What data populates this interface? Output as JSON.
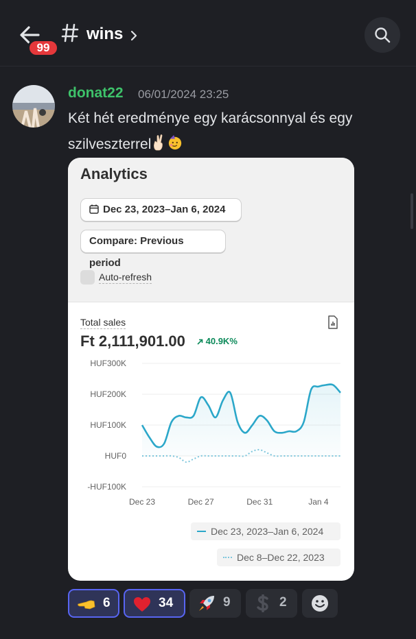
{
  "header": {
    "unread_count": "99",
    "channel_name": "wins"
  },
  "message": {
    "author": "donat22",
    "timestamp": "06/01/2024 23:25",
    "text_line1": "Két hét eredménye egy karácsonnyal és egy",
    "text_line2": "szilveszterrel"
  },
  "card": {
    "title": "Analytics",
    "date_range": "Dec 23, 2023–Jan 6, 2024",
    "compare": "Compare: Previous period",
    "auto_refresh": "Auto-refresh",
    "metric_label": "Total sales",
    "metric_value": "Ft 2,111,901.00",
    "metric_change": "40.9K%",
    "legend_current": "Dec 23, 2023–Jan 6, 2024",
    "legend_previous": "Dec 8–Dec 22, 2023"
  },
  "chart_data": {
    "type": "line",
    "y_ticks": [
      "HUF300K",
      "HUF200K",
      "HUF100K",
      "HUF0",
      "-HUF100K"
    ],
    "y_tick_values": [
      300000,
      200000,
      100000,
      0,
      -100000
    ],
    "ylim": [
      -100000,
      300000
    ],
    "x_tick_labels": [
      "Dec 23",
      "Dec 27",
      "Dec 31",
      "Jan 4"
    ],
    "x_tick_positions": [
      0,
      4,
      8,
      12
    ],
    "series": [
      {
        "name": "Dec 23, 2023–Jan 6, 2024",
        "color": "#2ba7c9",
        "points": [
          [
            0,
            100000
          ],
          [
            0.5,
            60000
          ],
          [
            1,
            30000
          ],
          [
            1.5,
            40000
          ],
          [
            2,
            110000
          ],
          [
            2.5,
            130000
          ],
          [
            3,
            125000
          ],
          [
            3.5,
            130000
          ],
          [
            4,
            190000
          ],
          [
            4.5,
            165000
          ],
          [
            5,
            125000
          ],
          [
            5.5,
            180000
          ],
          [
            6,
            205000
          ],
          [
            6.5,
            110000
          ],
          [
            7,
            75000
          ],
          [
            7.5,
            100000
          ],
          [
            8,
            130000
          ],
          [
            8.5,
            115000
          ],
          [
            9,
            80000
          ],
          [
            9.5,
            75000
          ],
          [
            10,
            80000
          ],
          [
            10.5,
            80000
          ],
          [
            11,
            110000
          ],
          [
            11.5,
            215000
          ],
          [
            12,
            225000
          ],
          [
            12.5,
            230000
          ],
          [
            13,
            230000
          ],
          [
            13.5,
            205000
          ]
        ]
      },
      {
        "name": "Dec 8–Dec 22, 2023",
        "color": "#7cc6dc",
        "points": [
          [
            0,
            0
          ],
          [
            0.5,
            0
          ],
          [
            1,
            0
          ],
          [
            1.5,
            0
          ],
          [
            2,
            0
          ],
          [
            2.5,
            -5000
          ],
          [
            3,
            -20000
          ],
          [
            3.5,
            -10000
          ],
          [
            4,
            0
          ],
          [
            4.5,
            0
          ],
          [
            5,
            0
          ],
          [
            5.5,
            0
          ],
          [
            6,
            0
          ],
          [
            6.5,
            0
          ],
          [
            7,
            0
          ],
          [
            7.5,
            15000
          ],
          [
            8,
            20000
          ],
          [
            8.5,
            10000
          ],
          [
            9,
            0
          ],
          [
            9.5,
            0
          ],
          [
            10,
            0
          ],
          [
            10.5,
            0
          ],
          [
            11,
            0
          ],
          [
            11.5,
            0
          ],
          [
            12,
            0
          ],
          [
            12.5,
            0
          ],
          [
            13,
            0
          ],
          [
            13.5,
            0
          ]
        ]
      }
    ]
  },
  "reactions": [
    {
      "emoji": "pointing-hand",
      "count": "6",
      "active": true
    },
    {
      "emoji": "red-heart",
      "count": "34",
      "active": true
    },
    {
      "emoji": "rocket",
      "count": "9",
      "active": false
    },
    {
      "emoji": "dollar-sign",
      "count": "2",
      "active": false
    },
    {
      "emoji": "add-reaction",
      "count": "",
      "active": false
    }
  ]
}
